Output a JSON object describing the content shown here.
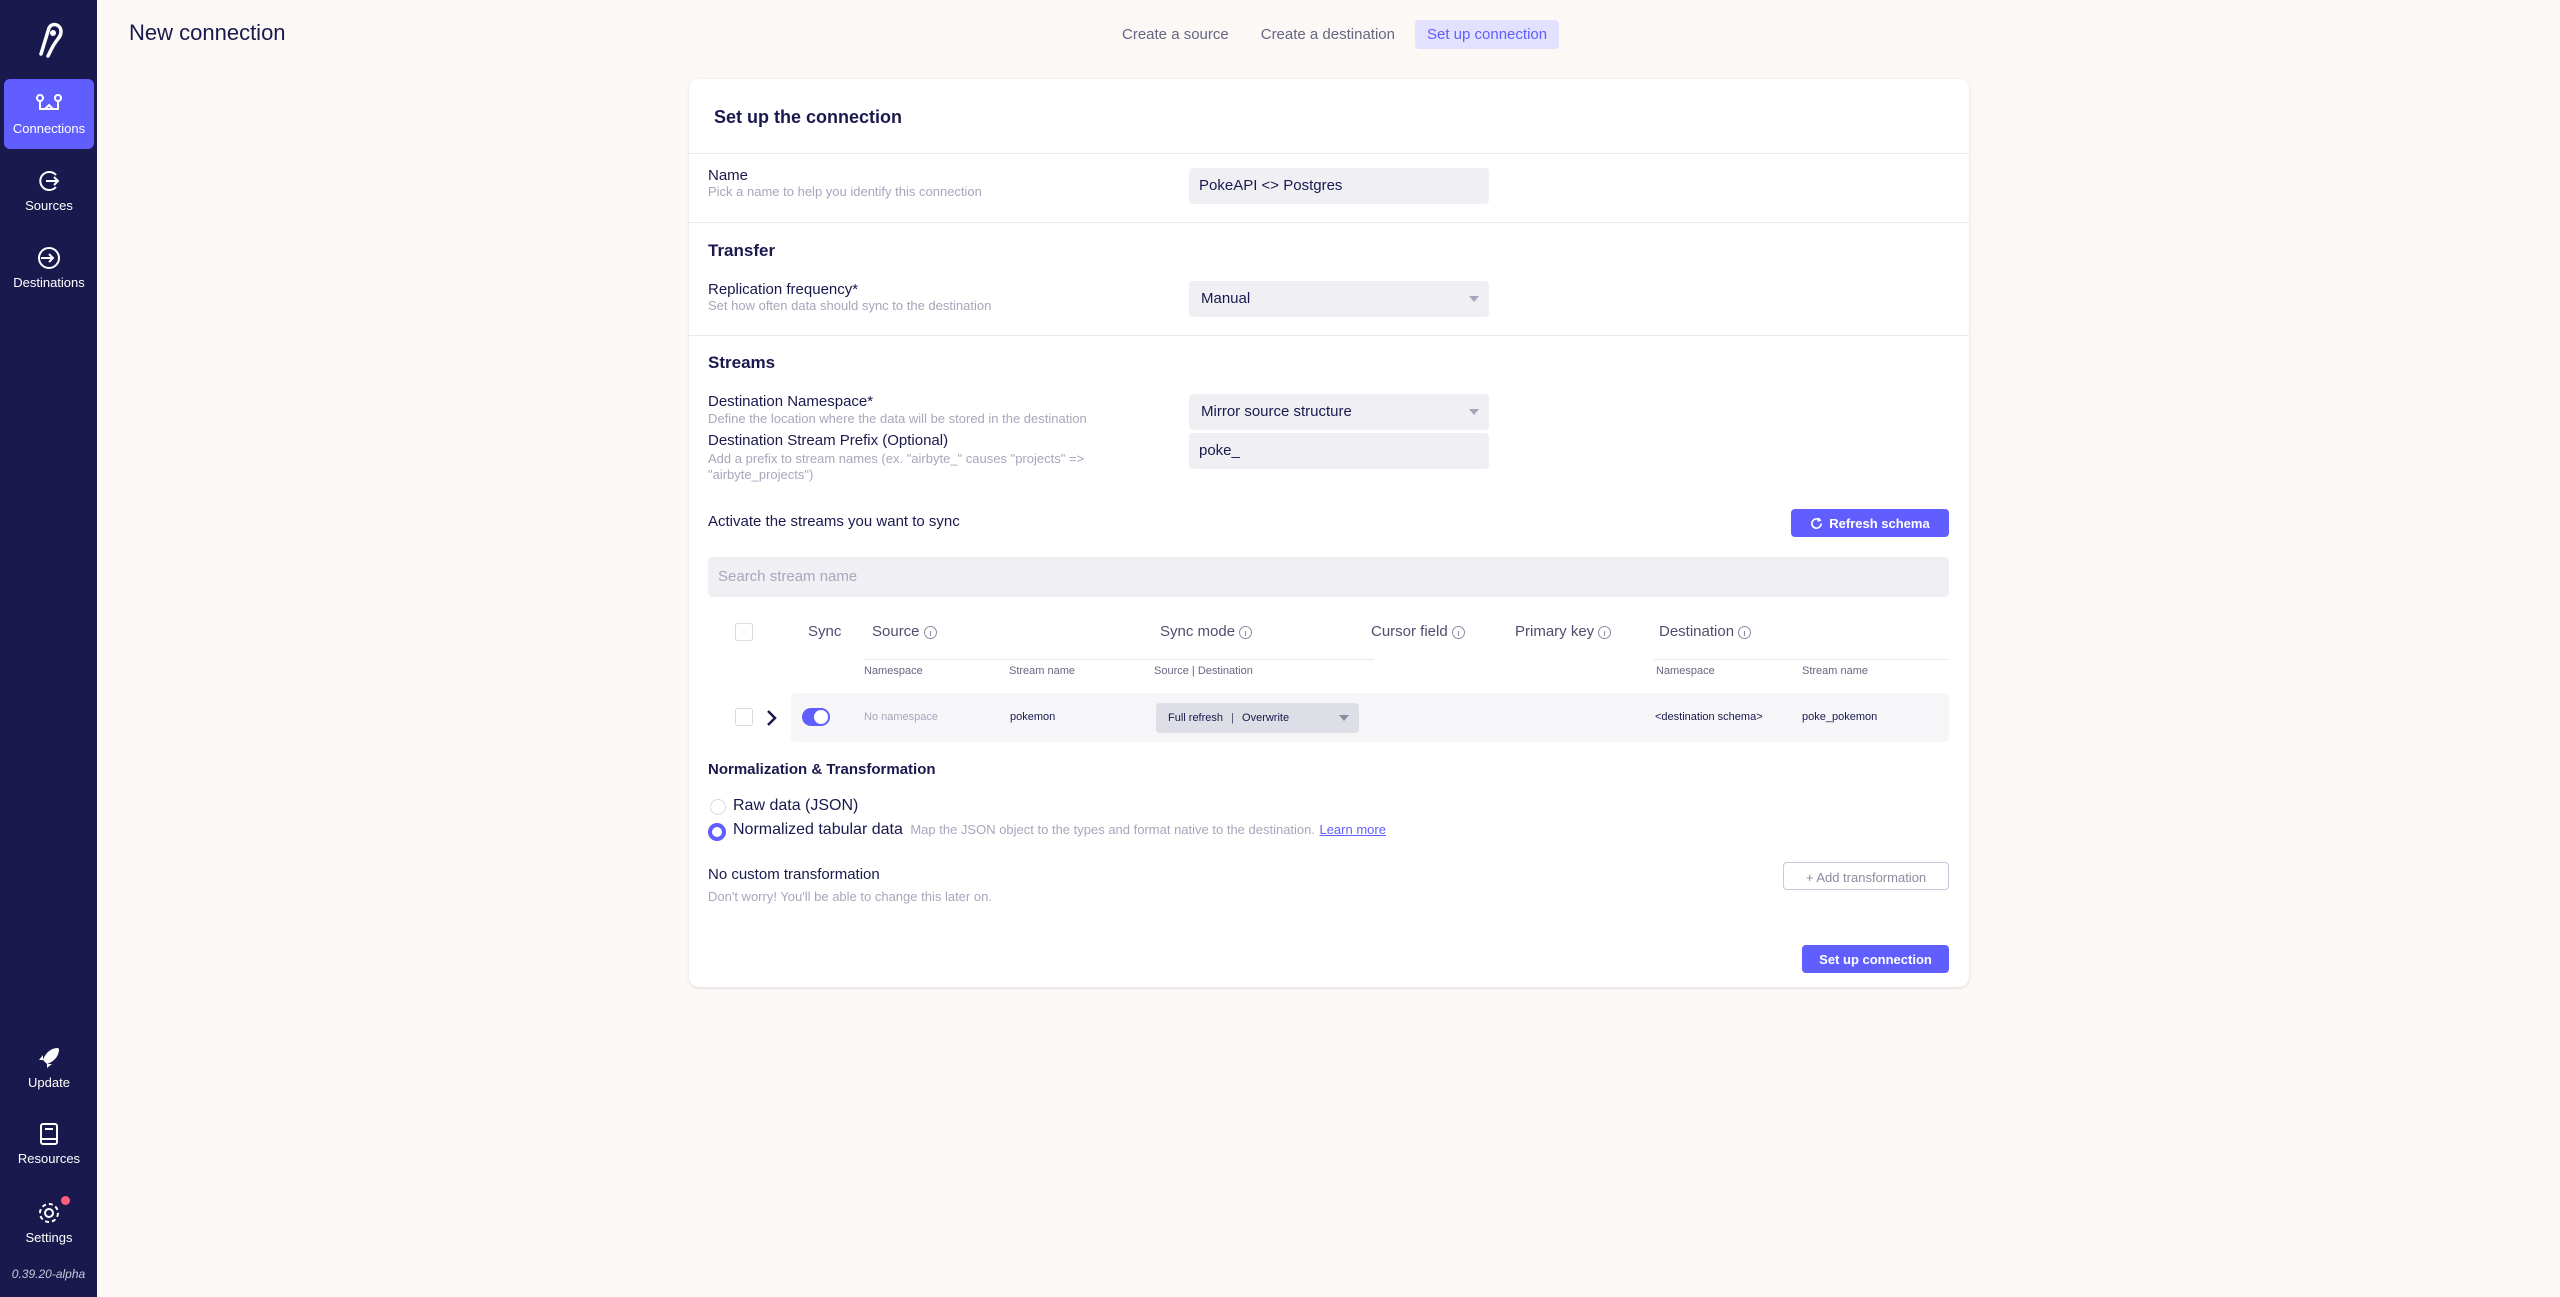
{
  "sidebar": {
    "logo_icon": "airbyte-logo-icon",
    "nav": [
      {
        "label": "Connections",
        "icon": "connections-icon",
        "active": true
      },
      {
        "label": "Sources",
        "icon": "sources-icon",
        "active": false
      },
      {
        "label": "Destinations",
        "icon": "destinations-icon",
        "active": false
      }
    ],
    "bottom": [
      {
        "label": "Update",
        "icon": "rocket-icon"
      },
      {
        "label": "Resources",
        "icon": "book-icon"
      },
      {
        "label": "Settings",
        "icon": "gear-icon"
      }
    ],
    "version": "0.39.20-alpha"
  },
  "header": {
    "title": "New connection",
    "steps": [
      "Create a source",
      "Create a destination",
      "Set up connection"
    ]
  },
  "card": {
    "title": "Set up the connection",
    "name": {
      "label": "Name",
      "help": "Pick a name to help you identify this connection",
      "value": "PokeAPI <> Postgres"
    },
    "transfer": {
      "title": "Transfer",
      "label": "Replication frequency*",
      "help": "Set how often data should sync to the destination",
      "value": "Manual"
    },
    "streams": {
      "title": "Streams",
      "namespace_label": "Destination Namespace*",
      "namespace_help": "Define the location where the data will be stored in the destination",
      "namespace_value": "Mirror source structure",
      "prefix_label": "Destination Stream Prefix (Optional)",
      "prefix_help_1": "Add a prefix to stream names (ex. \"airbyte_\" causes \"projects\" =>",
      "prefix_help_2": "\"airbyte_projects\")",
      "prefix_value": "poke_",
      "activate_label": "Activate the streams you want to sync",
      "refresh_button": "Refresh schema",
      "search_placeholder": "Search stream name",
      "table": {
        "headers": {
          "sync": "Sync",
          "source": "Source",
          "sync_mode": "Sync mode",
          "cursor_field": "Cursor field",
          "primary_key": "Primary key",
          "destination": "Destination"
        },
        "subheaders": {
          "src_namespace": "Namespace",
          "src_stream": "Stream name",
          "sync_mode": "Source | Destination",
          "dst_namespace": "Namespace",
          "dst_stream": "Stream name"
        },
        "rows": [
          {
            "src_namespace": "No namespace",
            "src_stream": "pokemon",
            "sync_mode_source": "Full refresh",
            "sync_mode_dest": "Overwrite",
            "dst_namespace": "<destination schema>",
            "dst_stream": "poke_pokemon",
            "enabled": true
          }
        ]
      }
    },
    "normalization": {
      "title": "Normalization & Transformation",
      "raw_label": "Raw data (JSON)",
      "normalized_label": "Normalized tabular data",
      "normalized_desc": "Map the JSON object to the types and format native to the destination.",
      "learn_more": "Learn more",
      "selected": "normalized",
      "no_custom_title": "No custom transformation",
      "no_custom_help": "Don't worry! You'll be able to change this later on.",
      "add_transformation": "+ Add transformation"
    },
    "submit_button": "Set up connection"
  },
  "colors": {
    "sidebar_bg": "#1a194d",
    "accent": "#615eff",
    "page_bg": "#fcf8f5"
  }
}
